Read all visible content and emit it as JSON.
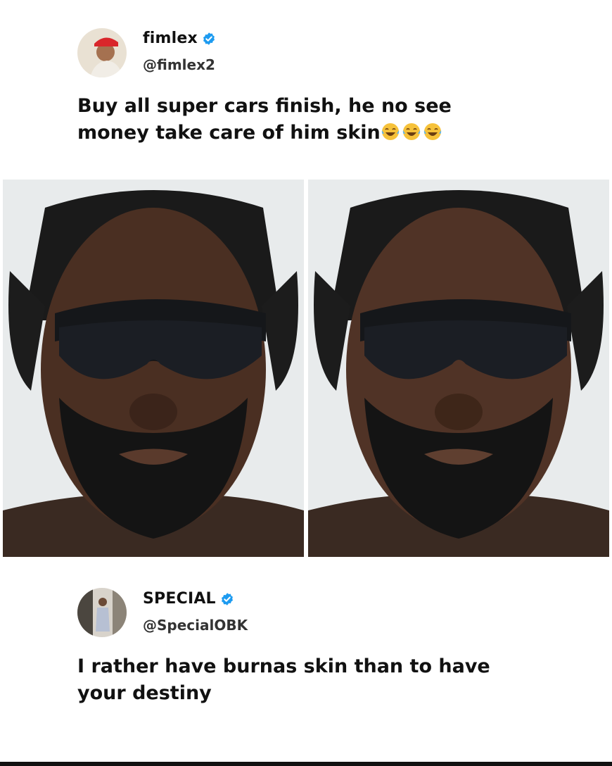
{
  "post": {
    "author": {
      "display_name": "fimlex",
      "handle": "@fimlex2",
      "verified": true,
      "avatar_icon": "avatar-red-cap"
    },
    "text_line1": "Buy all super cars finish, he no see",
    "text_line2": "money take care of him skin",
    "emojis": [
      "tears-of-joy-icon",
      "tears-of-joy-icon",
      "tears-of-joy-icon"
    ],
    "photos": [
      {
        "icon": "man-sunglasses-photo"
      },
      {
        "icon": "man-sunglasses-photo"
      }
    ]
  },
  "reply": {
    "author": {
      "display_name": "SPECIAL",
      "handle": "@SpecialOBK",
      "verified": true,
      "avatar_icon": "avatar-man-standing"
    },
    "text_line1": "I rather have burnas skin than to have",
    "text_line2": "your destiny"
  },
  "colors": {
    "verified_badge": "#1d9bf0",
    "text": "#111111",
    "background": "#ffffff"
  }
}
